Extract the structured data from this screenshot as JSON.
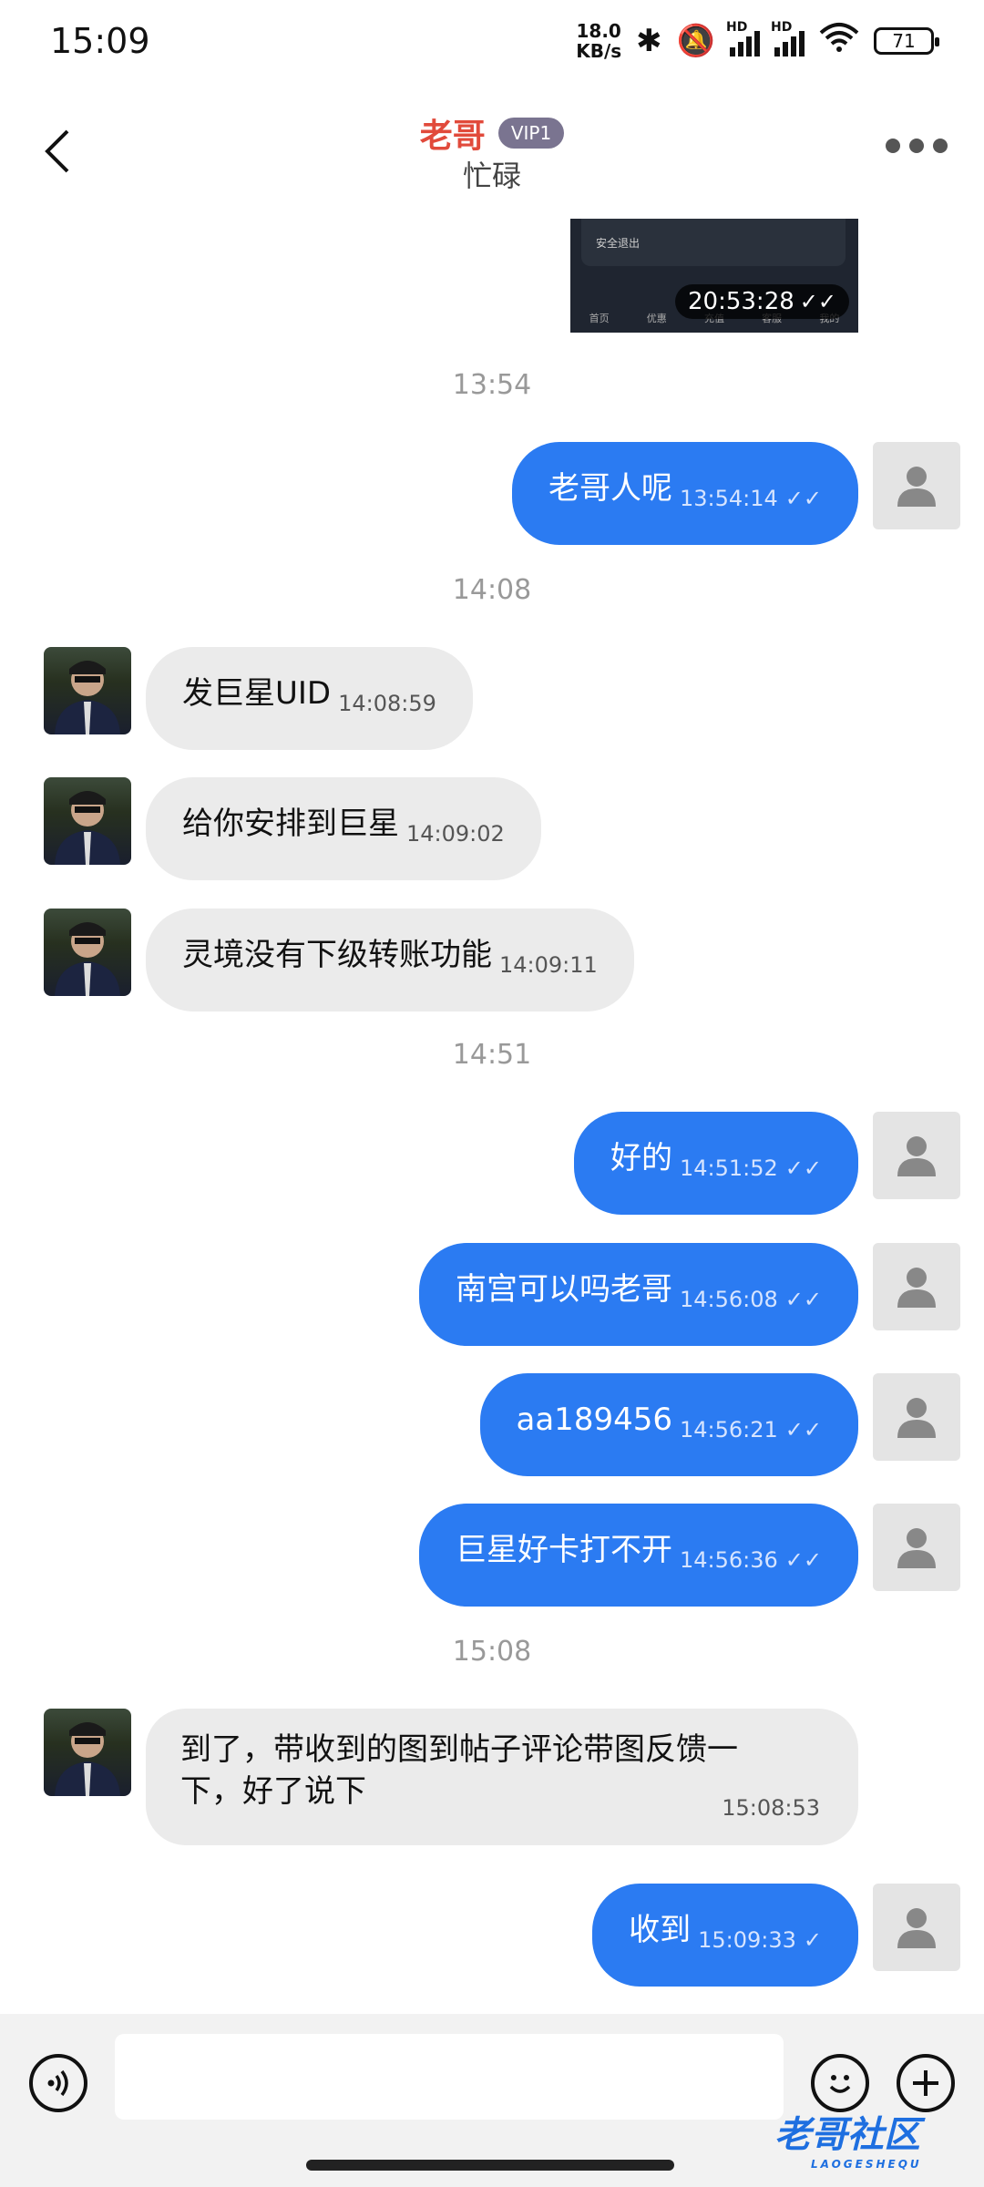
{
  "status_bar": {
    "time": "15:09",
    "net_speed_value": "18.0",
    "net_speed_unit": "KB/s",
    "hd1": "HD",
    "hd2": "HD",
    "battery": "71"
  },
  "header": {
    "title": "老哥",
    "vip": "VIP1",
    "subtitle": "忙碌"
  },
  "image_message": {
    "logout_text": "安全退出",
    "tabs": [
      "首页",
      "优惠",
      "充值",
      "客服",
      "我的"
    ],
    "timestamp": "20:53:28"
  },
  "time_separators": [
    "13:54",
    "14:08",
    "14:51",
    "15:08"
  ],
  "messages": [
    {
      "side": "me",
      "text": "老哥人呢",
      "time": "13:54:14",
      "status": "read"
    },
    {
      "side": "them",
      "text": "发巨星UID",
      "time": "14:08:59"
    },
    {
      "side": "them",
      "text": "给你安排到巨星",
      "time": "14:09:02"
    },
    {
      "side": "them",
      "text": "灵境没有下级转账功能",
      "time": "14:09:11"
    },
    {
      "side": "me",
      "text": "好的",
      "time": "14:51:52",
      "status": "read"
    },
    {
      "side": "me",
      "text": "南宫可以吗老哥",
      "time": "14:56:08",
      "status": "read"
    },
    {
      "side": "me",
      "text": "aa189456",
      "time": "14:56:21",
      "status": "read"
    },
    {
      "side": "me",
      "text": "巨星好卡打不开",
      "time": "14:56:36",
      "status": "read"
    },
    {
      "side": "them",
      "text_line1": "到了，带收到的图到帖子评论带图反馈一",
      "text_line2": "下，好了说下",
      "time": "15:08:53"
    },
    {
      "side": "me",
      "text": "收到",
      "time": "15:09:33",
      "status": "sent"
    }
  ],
  "input": {
    "placeholder": ""
  },
  "watermark": {
    "text": "老哥社区",
    "sub": "LAOGESHEQU"
  },
  "colors": {
    "my_bubble": "#2b7bf2",
    "their_bubble": "#ebebeb",
    "title": "#e14a3b",
    "vip_badge": "#7a7490"
  }
}
